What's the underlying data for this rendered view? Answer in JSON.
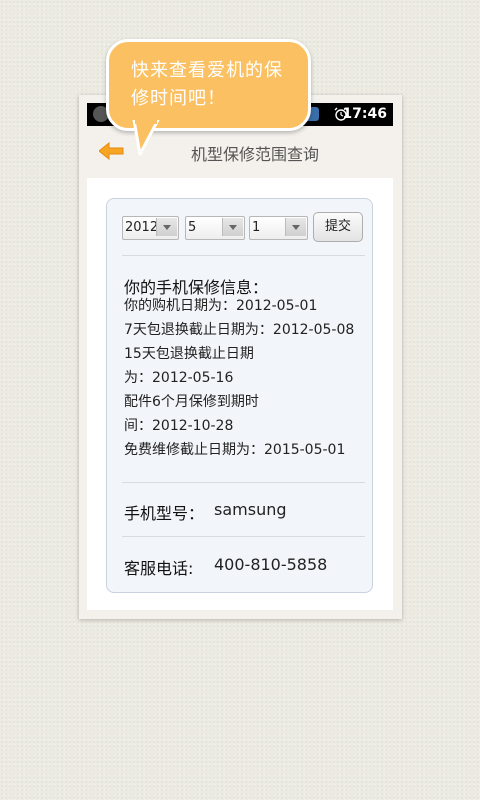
{
  "bubble": {
    "line1": "快来查看爱机的保",
    "line2": "修时间吧！"
  },
  "status_bar": {
    "time": "17:46",
    "icons": [
      "app-icon",
      "notification-icon",
      "alarm-icon"
    ]
  },
  "header": {
    "title": "机型保修范围查询",
    "back_icon": "back-arrow-icon"
  },
  "date_picker": {
    "year": "2012",
    "month": "5",
    "day": "1",
    "submit_label": "提交"
  },
  "warranty": {
    "title": "你的手机保修信息：",
    "lines": [
      "你的购机日期为：2012-05-01",
      "7天包退换截止日期为：2012-05-08",
      "15天包退换截止日期",
      "为：2012-05-16",
      "配件6个月保修到期时",
      "间：2012-10-28",
      "免费维修截止日期为：2015-05-01"
    ]
  },
  "model": {
    "label": "手机型号：",
    "value": "samsung"
  },
  "service": {
    "label": "客服电话:",
    "value": "400-810-5858"
  },
  "colors": {
    "bubble": "#fbc061",
    "back_arrow": "#f6a623",
    "card_bg": "#f2f5f9",
    "card_border": "#c9d3de"
  }
}
